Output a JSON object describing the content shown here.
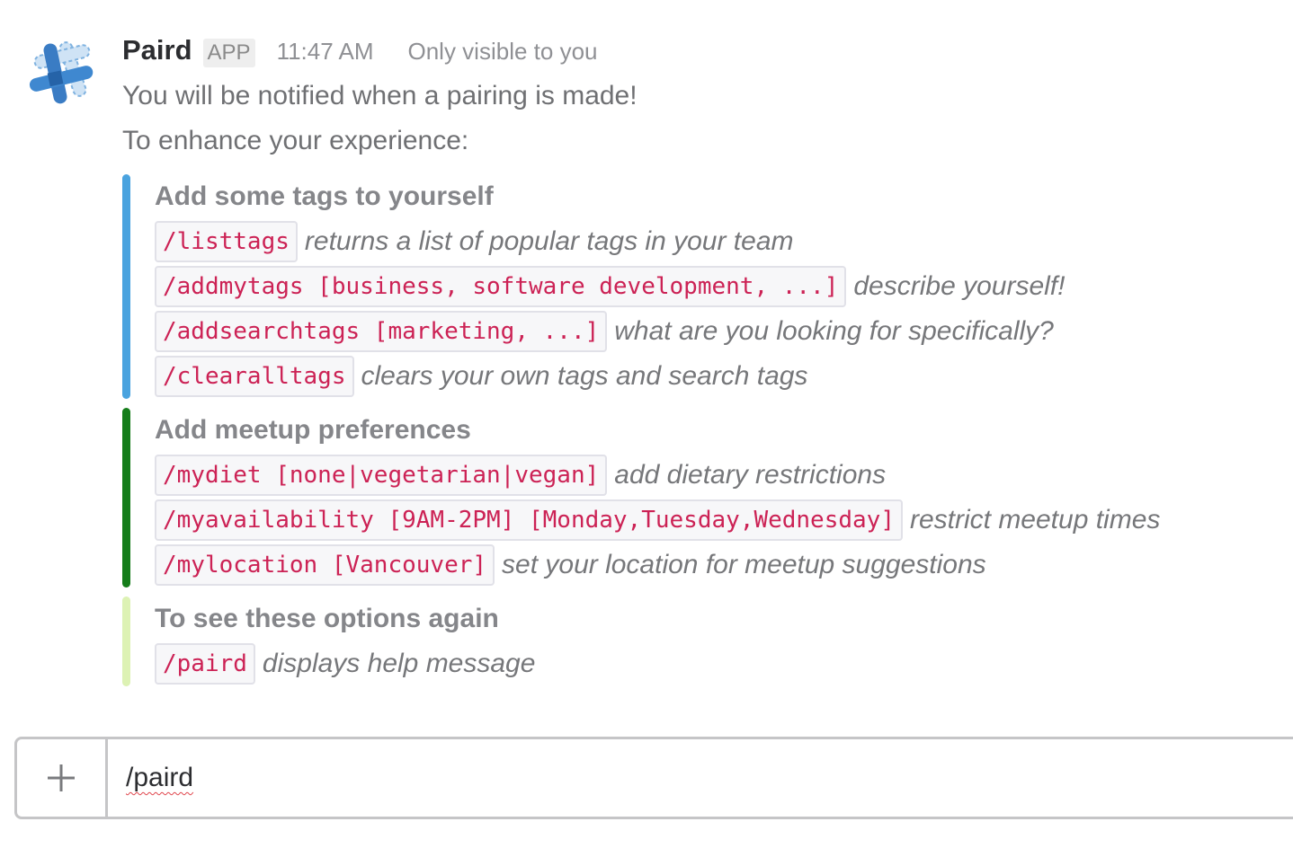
{
  "message": {
    "avatar_icon": "paird-logo-icon",
    "sender": "Paird",
    "badge": "APP",
    "time": "11:47 AM",
    "visibility": "Only visible to you",
    "lines": [
      "You will be notified when a pairing is made!",
      "To enhance your experience:"
    ]
  },
  "attachments": [
    {
      "color": "#4aa3df",
      "title": "Add some tags to yourself",
      "commands": [
        {
          "cmd": "/listtags",
          "desc": "returns a list of popular tags in your team"
        },
        {
          "cmd": "/addmytags [business, software development, ...]",
          "desc": "describe yourself!"
        },
        {
          "cmd": "/addsearchtags [marketing, ...]",
          "desc": "what are you looking for specifically?"
        },
        {
          "cmd": "/clearalltags",
          "desc": "clears your own tags and search tags"
        }
      ]
    },
    {
      "color": "#157d1a",
      "title": "Add meetup preferences",
      "commands": [
        {
          "cmd": "/mydiet [none|vegetarian|vegan]",
          "desc": "add dietary restrictions"
        },
        {
          "cmd": "/myavailability [9AM-2PM] [Monday,Tuesday,Wednesday]",
          "desc": "restrict meetup times"
        },
        {
          "cmd": "/mylocation [Vancouver]",
          "desc": "set your location for meetup suggestions"
        }
      ]
    },
    {
      "color": "#ddf2b4",
      "title": "To see these options again",
      "commands": [
        {
          "cmd": "/paird",
          "desc": "displays help message"
        }
      ]
    }
  ],
  "composer": {
    "plus_icon": "plus-icon",
    "value": "/paird"
  }
}
